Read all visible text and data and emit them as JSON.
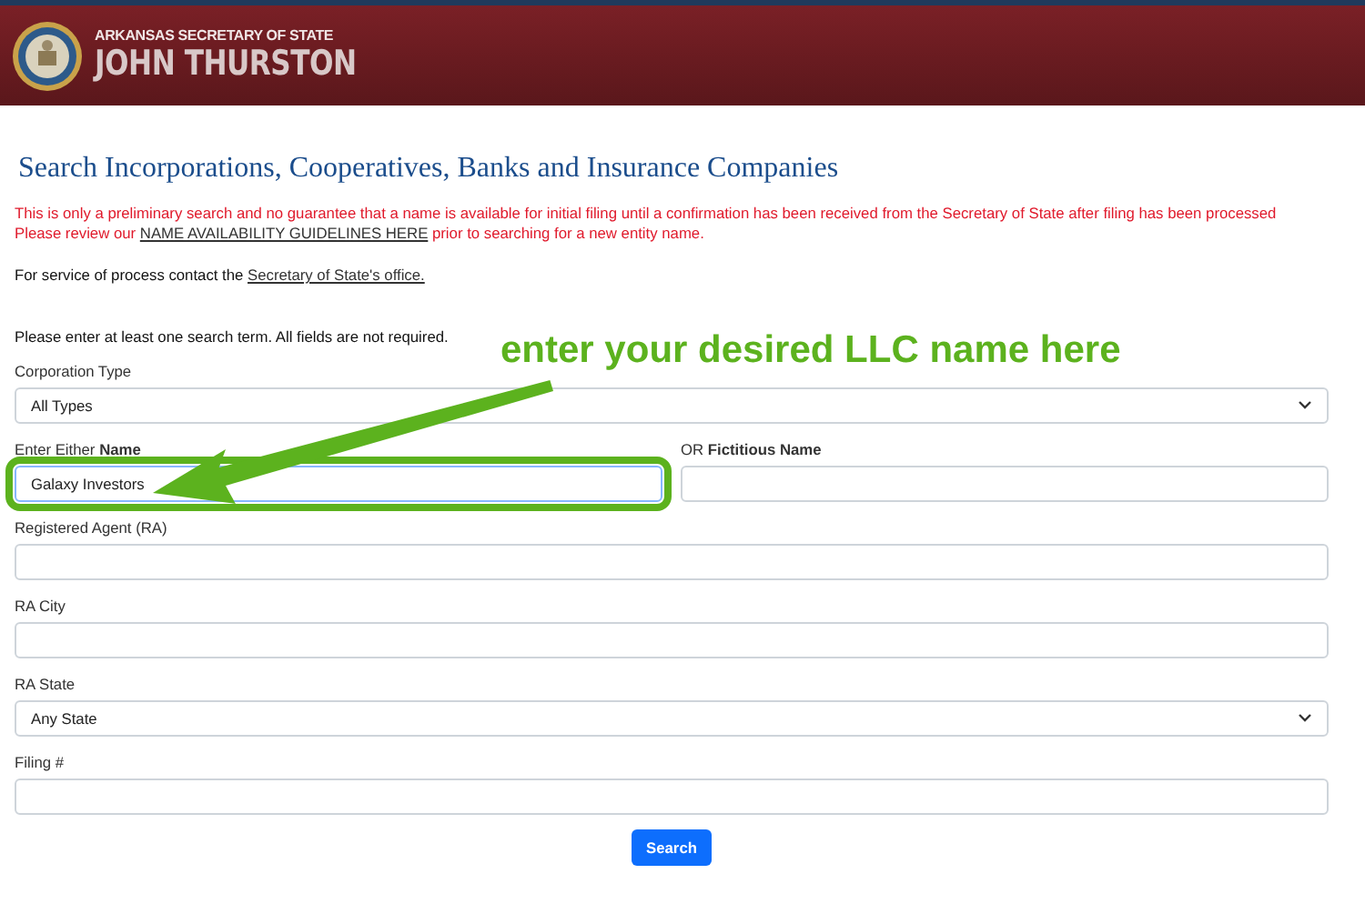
{
  "header": {
    "subtitle": "ARKANSAS SECRETARY OF STATE",
    "title": "JOHN THURSTON"
  },
  "page_title": "Search Incorporations, Cooperatives, Banks and Insurance Companies",
  "notice": {
    "line_1": "This is only a preliminary search and no guarantee that a name is available for initial filing until a confirmation has been received from the Secretary of State after filing has been processed",
    "line_2_before": "Please review our ",
    "line_2_link": "NAME AVAILABILITY GUIDELINES HERE",
    "line_2_after": " prior to searching for a new entity name."
  },
  "service": {
    "before": "For service of process contact the ",
    "link": "Secretary of State's office."
  },
  "instructions": "Please enter at least one search term. All fields are not required.",
  "rows": [
    {
      "fields": [
        {
          "kind": "select",
          "label": "Corporation Type",
          "value": "All Types",
          "highlighted": false
        }
      ]
    },
    {
      "fields": [
        {
          "kind": "input",
          "label": "Enter Either **Name**",
          "value": "Galaxy Investors",
          "highlighted": true
        },
        {
          "kind": "input",
          "label": "OR **Fictitious Name**",
          "highlighted": false
        }
      ]
    },
    {
      "fields": [
        {
          "kind": "input",
          "label": "Registered Agent (RA)",
          "highlighted": false
        }
      ]
    },
    {
      "fields": [
        {
          "kind": "input",
          "label": "RA City",
          "highlighted": false
        }
      ]
    },
    {
      "fields": [
        {
          "kind": "select",
          "label": "RA State",
          "value": "Any State",
          "highlighted": false
        }
      ]
    },
    {
      "fields": [
        {
          "kind": "input",
          "label": "Filing #",
          "highlighted": false
        }
      ]
    }
  ],
  "search_button": "Search",
  "annotation": {
    "text": "enter your desired LLC name here"
  }
}
